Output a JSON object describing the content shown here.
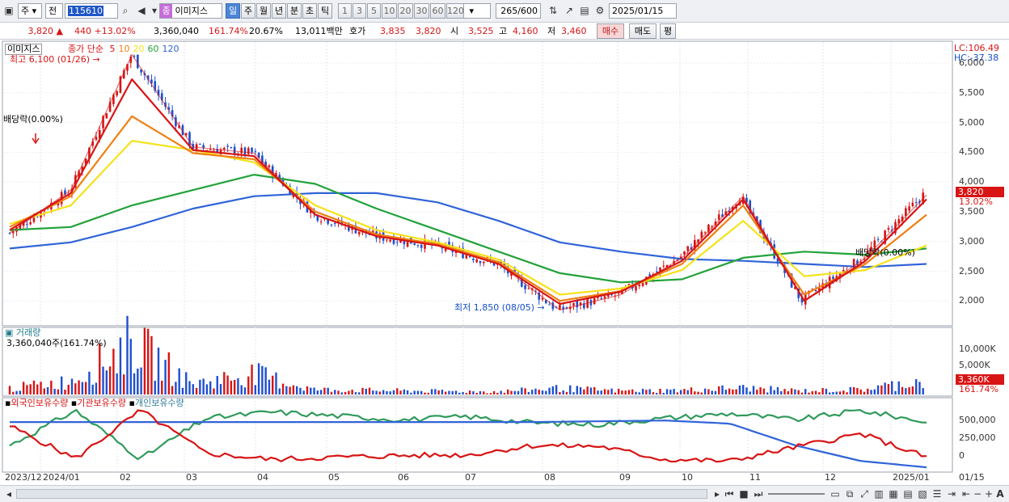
{
  "toolbar": {
    "market_type": "주",
    "prev_label": "전",
    "code": "115610",
    "stock_badge": "종",
    "stock_name": "이미지스",
    "periods": [
      "일",
      "주",
      "월",
      "년",
      "분",
      "초",
      "틱"
    ],
    "selected_period": "일",
    "intervals": [
      "1",
      "3",
      "5",
      "10",
      "20",
      "30",
      "60",
      "120"
    ],
    "count": "265",
    "count_total": "/600",
    "date": "2025/01/15"
  },
  "quote": {
    "price": "3,820",
    "change": "440",
    "change_pct": "+13.02%",
    "volume": "3,360,040",
    "volume_ratio": "161.74%",
    "turnover": "20.67%",
    "amount": "13,011백만",
    "ask_label": "호가",
    "ask1": "3,835",
    "ask2": "3,820",
    "open_label": "시",
    "open": "3,525",
    "high_label": "고",
    "high": "4,160",
    "low_label": "저",
    "low": "3,460",
    "buy_label": "매수",
    "sell_label": "매도",
    "avg_label": "평"
  },
  "price_panel": {
    "title": "이미지스",
    "ma_title": "종가 단순",
    "ma_periods": [
      "5",
      "10",
      "20",
      "60",
      "120"
    ],
    "ma_colors": [
      "#d81414",
      "#f07f12",
      "#f5e21a",
      "#22a23a",
      "#3064d8"
    ],
    "high_note": "최고 6,100 (01/26)",
    "low_note": "최저 1,850 (08/05)",
    "dividend_note": "배당락(0.00%)",
    "dividend_note2": "배당락(0.00%)",
    "lc": "LC:106.49",
    "hc": "HC:-37.38",
    "price_tag": "3,820",
    "pct_tag": "13.02%",
    "yticks": [
      "6,000",
      "5,500",
      "5,000",
      "4,500",
      "4,000",
      "3,500",
      "3,000",
      "2,500",
      "2,000"
    ]
  },
  "volume_panel": {
    "title": "거래량",
    "current": "3,360,040주(161.74%)",
    "yticks": [
      "10,000K",
      "5,000K"
    ],
    "vol_tag": "3,360K",
    "pct_tag": "161.74%"
  },
  "holding_panel": {
    "series_names": [
      "외국인보유수량",
      "기관보유수량",
      "개인보유수량"
    ],
    "series_colors": [
      "#d81414",
      "#3064d8",
      "#2f9a5a"
    ],
    "yticks": [
      "500,000",
      "250,000",
      "0"
    ]
  },
  "xaxis": {
    "labels": [
      "2023/12",
      "2024/01",
      "02",
      "03",
      "04",
      "05",
      "06",
      "07",
      "08",
      "09",
      "10",
      "11",
      "12",
      "2025/01",
      "01/15"
    ]
  },
  "chart_data": [
    {
      "type": "line",
      "title": "이미지스",
      "x": [
        "2023/12",
        "2024/01",
        "01/26",
        "02",
        "03",
        "04",
        "05",
        "06",
        "07",
        "08/05",
        "09",
        "10",
        "11",
        "12",
        "2025/01",
        "01/15"
      ],
      "series": [
        {
          "name": "종가",
          "values": [
            3200,
            3900,
            6100,
            4600,
            4500,
            3500,
            3150,
            3000,
            2700,
            1950,
            2200,
            2800,
            3800,
            2100,
            2800,
            3820
          ]
        },
        {
          "name": "5",
          "values": [
            3250,
            3850,
            5700,
            4550,
            4450,
            3500,
            3150,
            3000,
            2700,
            2050,
            2250,
            2750,
            3750,
            2100,
            2750,
            3750
          ]
        },
        {
          "name": "10",
          "values": [
            3300,
            3800,
            5100,
            4500,
            4400,
            3550,
            3180,
            3020,
            2730,
            2100,
            2260,
            2700,
            3650,
            2200,
            2700,
            3500
          ]
        },
        {
          "name": "20",
          "values": [
            3350,
            3650,
            4700,
            4550,
            4350,
            3650,
            3250,
            3050,
            2770,
            2200,
            2300,
            2600,
            3400,
            2500,
            2600,
            3000
          ]
        },
        {
          "name": "60",
          "values": [
            3250,
            3300,
            3650,
            3900,
            4150,
            4000,
            3600,
            3250,
            2900,
            2550,
            2400,
            2450,
            2800,
            2900,
            2850,
            2950
          ]
        },
        {
          "name": "120",
          "values": [
            2950,
            3050,
            3300,
            3600,
            3800,
            3850,
            3850,
            3700,
            3400,
            3050,
            2900,
            2780,
            2750,
            2700,
            2650,
            2700
          ]
        }
      ],
      "ylim": [
        1800,
        6200
      ]
    },
    {
      "type": "bar",
      "title": "거래량",
      "categories": [
        "2023/12",
        "2024/01",
        "01/26",
        "02",
        "03",
        "04",
        "05",
        "06",
        "07",
        "08",
        "09",
        "10",
        "11",
        "12",
        "2025/01",
        "01/15"
      ],
      "values": [
        1500,
        3200,
        12500,
        2500,
        5000,
        1200,
        1000,
        800,
        700,
        1500,
        900,
        1000,
        1600,
        900,
        1200,
        3360
      ],
      "ylim": [
        0,
        13000
      ]
    },
    {
      "type": "line",
      "title": "보유수량",
      "x": [
        "2023/12",
        "2024/01",
        "02",
        "03",
        "04",
        "05",
        "06",
        "07",
        "08",
        "09",
        "10",
        "11",
        "12",
        "2025/01",
        "01/15"
      ],
      "series": [
        {
          "name": "외국인보유수량",
          "values": [
            400000,
            -20000,
            600000,
            50000,
            -30000,
            0,
            20000,
            30000,
            150000,
            140000,
            -30000,
            -50000,
            130000,
            300000,
            0
          ]
        },
        {
          "name": "기관보유수량",
          "values": [
            450000,
            450000,
            450000,
            450000,
            450000,
            450000,
            450000,
            450000,
            450000,
            460000,
            470000,
            430000,
            150000,
            -50000,
            -130000
          ]
        },
        {
          "name": "개인보유수량",
          "values": [
            150000,
            600000,
            -20000,
            500000,
            580000,
            530000,
            480000,
            520000,
            440000,
            420000,
            500000,
            560000,
            480000,
            600000,
            450000
          ]
        }
      ],
      "ylim": [
        -150000,
        700000
      ]
    }
  ]
}
